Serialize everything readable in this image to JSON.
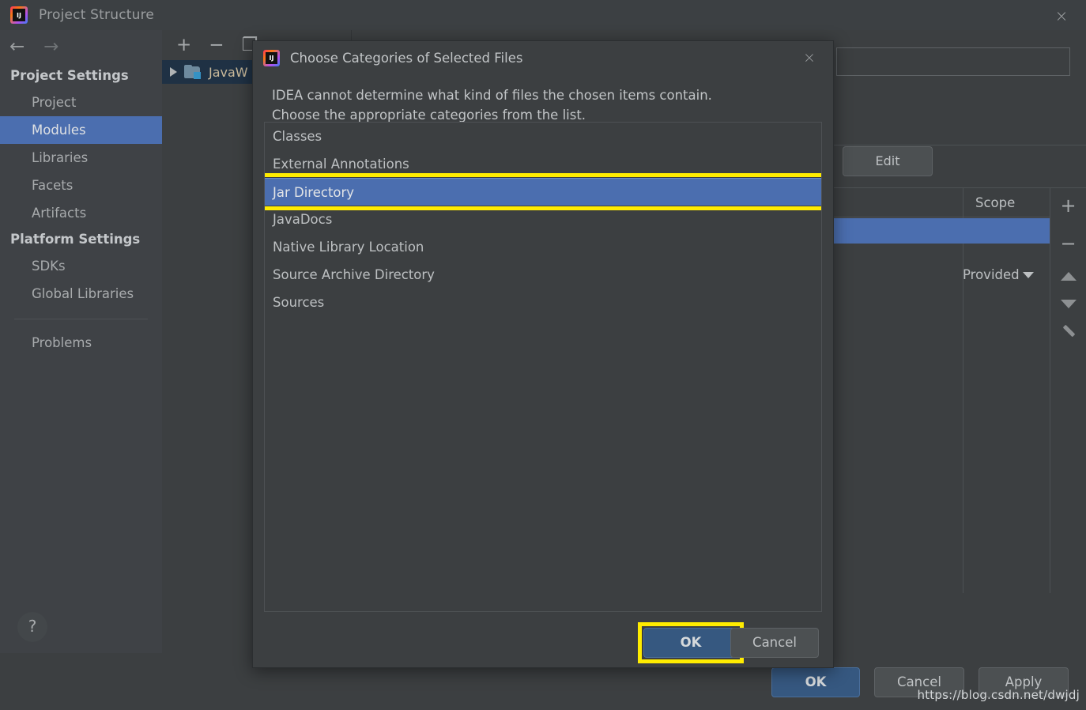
{
  "window": {
    "title": "Project Structure",
    "icon": "intellij-idea-icon",
    "close_label": "×"
  },
  "sidebar": {
    "back_icon": "←",
    "forward_icon": "→",
    "groups": [
      {
        "label": "Project Settings",
        "items": [
          {
            "label": "Project",
            "selected": false
          },
          {
            "label": "Modules",
            "selected": true
          },
          {
            "label": "Libraries",
            "selected": false
          },
          {
            "label": "Facets",
            "selected": false
          },
          {
            "label": "Artifacts",
            "selected": false
          }
        ]
      },
      {
        "label": "Platform Settings",
        "items": [
          {
            "label": "SDKs",
            "selected": false
          },
          {
            "label": "Global Libraries",
            "selected": false
          }
        ]
      }
    ],
    "problems_label": "Problems",
    "help_label": "?"
  },
  "modules_panel": {
    "toolbar": [
      {
        "name": "add-module-button",
        "glyph": "+"
      },
      {
        "name": "remove-module-button",
        "glyph": "−"
      },
      {
        "name": "copy-module-button",
        "glyph": "❐"
      }
    ],
    "tree": [
      {
        "label": "JavaW",
        "expander": "▶",
        "selected": true
      }
    ]
  },
  "right_panel": {
    "field_value": "",
    "edit_button": "Edit",
    "column_headers": [
      "",
      "Scope"
    ],
    "scope_value": "Provided",
    "toolbar": [
      {
        "name": "add-dependency-button",
        "glyph": "+"
      },
      {
        "name": "remove-dependency-button",
        "glyph": "−"
      },
      {
        "name": "move-up-button",
        "glyph": "▲"
      },
      {
        "name": "move-down-button",
        "glyph": "▼"
      },
      {
        "name": "edit-dependency-button",
        "glyph": "✎"
      }
    ]
  },
  "main_buttons": {
    "ok": "OK",
    "cancel": "Cancel",
    "apply": "Apply"
  },
  "dialog": {
    "title": "Choose Categories of Selected Files",
    "icon": "intellij-idea-icon",
    "close_label": "×",
    "message_line1": "IDEA cannot determine what kind of files the chosen items contain.",
    "message_line2": "Choose the appropriate categories from the list.",
    "categories": [
      {
        "label": "Classes",
        "selected": false
      },
      {
        "label": "External Annotations",
        "selected": false
      },
      {
        "label": "Jar Directory",
        "selected": true
      },
      {
        "label": "JavaDocs",
        "selected": false
      },
      {
        "label": "Native Library Location",
        "selected": false
      },
      {
        "label": "Source Archive Directory",
        "selected": false
      },
      {
        "label": "Sources",
        "selected": false
      }
    ],
    "ok": "OK",
    "cancel": "Cancel"
  },
  "watermark": "https://blog.csdn.net/dwjdj",
  "colors": {
    "accent_selection": "#4b6eaf",
    "highlight_yellow": "#ffec00",
    "default_button": "#365880",
    "panel_bg": "#3c3f41",
    "sidebar_bg": "#3f4246"
  }
}
